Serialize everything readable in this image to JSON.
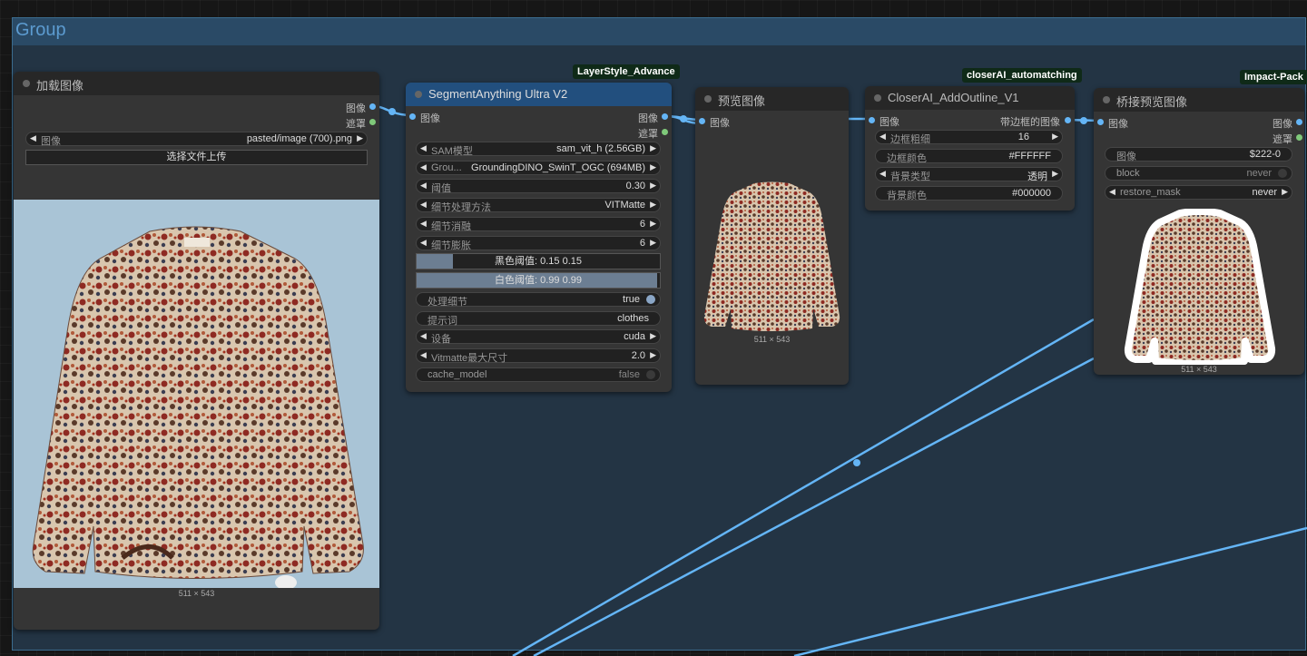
{
  "group": {
    "title": "Group"
  },
  "badges": {
    "layerstyle": "LayerStyle_Advance",
    "closerai": "closerAI_automatching",
    "impact": "Impact-Pack"
  },
  "load_image": {
    "title": "加载图像",
    "out_image": "图像",
    "out_mask": "遮罩",
    "image_label": "图像",
    "image_value": "pasted/image (700).png",
    "upload_label": "选择文件上传",
    "dims": "511 × 543"
  },
  "segment": {
    "title": "SegmentAnything Ultra V2",
    "in_image": "图像",
    "out_image": "图像",
    "out_mask": "遮罩",
    "widgets": [
      {
        "label": "SAM模型",
        "value": "sam_vit_h (2.56GB)"
      },
      {
        "label": "Grou...",
        "value": "GroundingDINO_SwinT_OGC (694MB)"
      },
      {
        "label": "阈值",
        "value": "0.30"
      },
      {
        "label": "细节处理方法",
        "value": "VITMatte"
      },
      {
        "label": "细节消融",
        "value": "6"
      },
      {
        "label": "细节膨胀",
        "value": "6"
      }
    ],
    "black_threshold": {
      "label": "黑色阈值: 0.15  0.15",
      "fill": 0.15
    },
    "white_threshold": {
      "label": "白色阈值: 0.99  0.99",
      "fill": 0.99
    },
    "process_detail": {
      "label": "处理细节",
      "value": "true"
    },
    "prompt": {
      "label": "提示词",
      "value": "clothes"
    },
    "device": {
      "label": "设备",
      "value": "cuda"
    },
    "vitmatte": {
      "label": "Vitmatte最大尺寸",
      "value": "2.0"
    },
    "cache": {
      "label": "cache_model",
      "value": "false"
    }
  },
  "preview": {
    "title": "预览图像",
    "in_image": "图像",
    "dims": "511 × 543"
  },
  "outline": {
    "title": "CloserAI_AddOutline_V1",
    "in_image": "图像",
    "out_image": "带边框的图像",
    "widgets": [
      {
        "label": "边框粗细",
        "value": "16",
        "arrows": true
      },
      {
        "label": "边框颜色",
        "value": "#FFFFFF",
        "arrows": false
      },
      {
        "label": "背景类型",
        "value": "透明",
        "arrows": true
      },
      {
        "label": "背景颜色",
        "value": "#000000",
        "arrows": false
      }
    ]
  },
  "bridge": {
    "title": "桥接预览图像",
    "in_image": "图像",
    "out_image": "图像",
    "out_mask": "遮罩",
    "image_widget": {
      "label": "图像",
      "value": "$222-0"
    },
    "block": {
      "label": "block",
      "value": "never"
    },
    "restore_mask": {
      "label": "restore_mask",
      "value": "never"
    },
    "dims": "511 × 543"
  },
  "colors": {
    "wire": "#64b5f6",
    "group_border": "#3b6c8e",
    "group_title": "#5c9bd0",
    "selected_header": "#224f7e"
  }
}
